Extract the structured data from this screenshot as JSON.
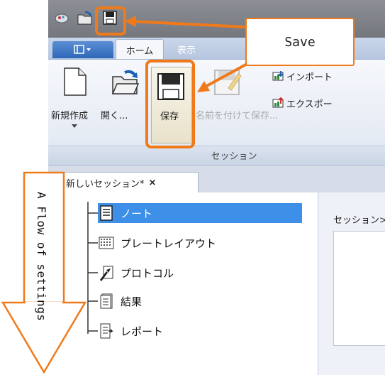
{
  "quick_access": {
    "icons": [
      "app-icon",
      "open-folder-icon",
      "save-icon"
    ]
  },
  "tabs": {
    "app_menu_icon": "window-menu-icon",
    "home": "ホーム",
    "view": "表示"
  },
  "ribbon": {
    "new": "新規作成",
    "open": "開く...",
    "save": "保存",
    "save_as": "名前を付けて保存...",
    "import": "インポート",
    "export": "エクスポー",
    "group_label": "セッション"
  },
  "document_tab": {
    "label": "新しいセッション*",
    "close": "×"
  },
  "tree": {
    "items": [
      {
        "label": "ノート",
        "icon": "note-icon",
        "selected": true
      },
      {
        "label": "プレートレイアウト",
        "icon": "plate-grid-icon",
        "selected": false
      },
      {
        "label": "プロトコル",
        "icon": "protocol-icon",
        "selected": false
      },
      {
        "label": "結果",
        "icon": "results-icon",
        "selected": false
      },
      {
        "label": "レポート",
        "icon": "report-icon",
        "selected": false
      }
    ]
  },
  "right_panel": {
    "label": "セッション>"
  },
  "annotations": {
    "save_callout": "Save",
    "flow_label": "A Flow of settings",
    "accent_color": "#f07a1a"
  }
}
